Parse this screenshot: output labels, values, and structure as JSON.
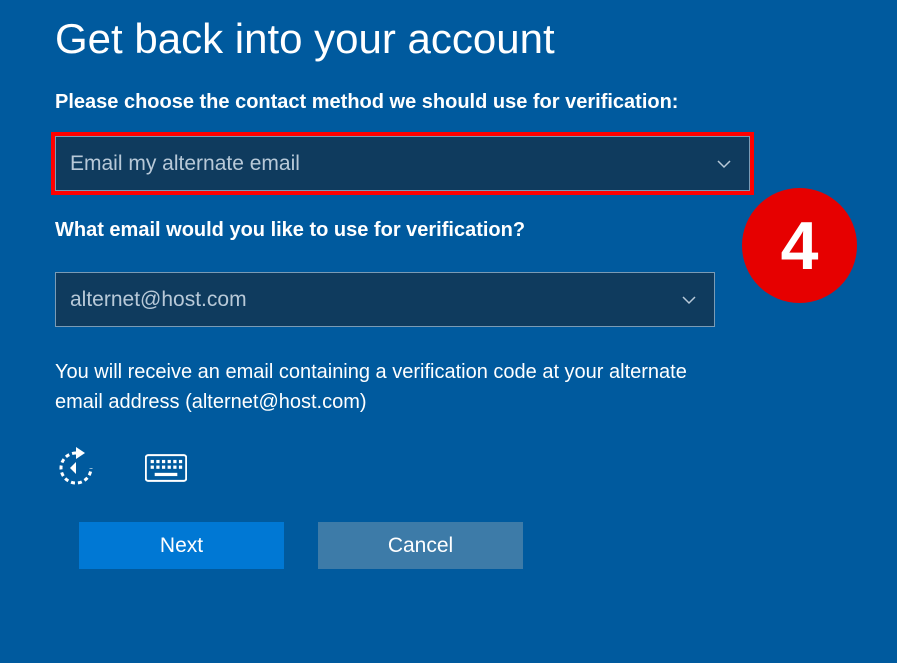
{
  "title": "Get back into your account",
  "contact_method": {
    "label": "Please choose the contact method we should use for verification:",
    "selected": "Email my alternate email"
  },
  "email_select": {
    "label": "What email would you like to use for verification?",
    "selected": "alternet@host.com"
  },
  "info": {
    "prefix": "You will receive an email containing a verification code at your alternate email address",
    "email_in_parens": "(alternet@host.com)"
  },
  "buttons": {
    "next": "Next",
    "cancel": "Cancel"
  },
  "step_badge": "4"
}
